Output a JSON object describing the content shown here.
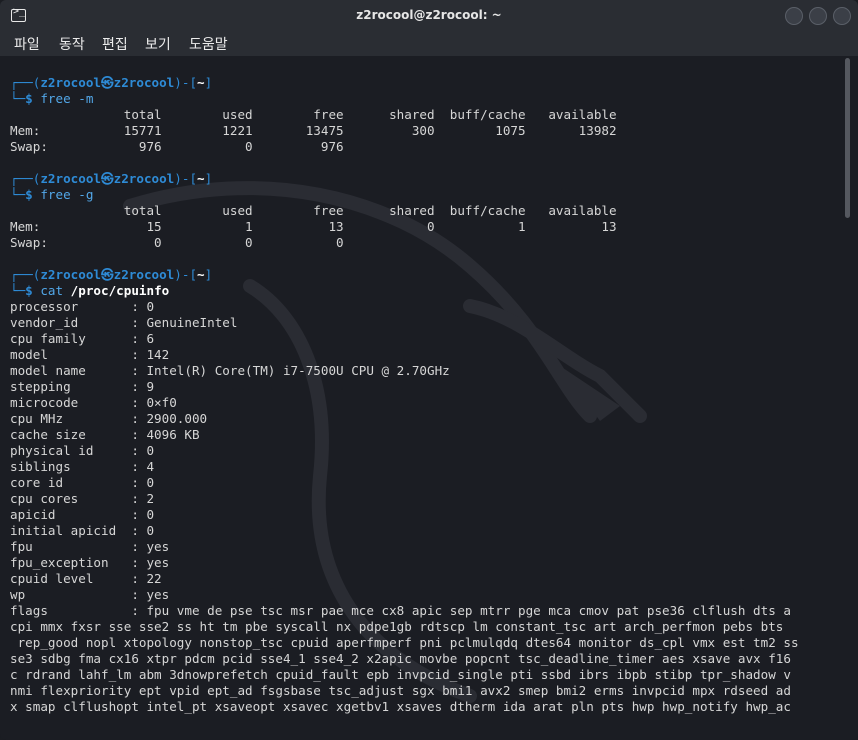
{
  "window": {
    "title": "z2rocool@z2rocool: ~",
    "icon": "terminal-icon",
    "buttons": [
      "minimize-button",
      "maximize-button",
      "close-button"
    ]
  },
  "menu": [
    "파일",
    "동작",
    "편집",
    "보기",
    "도움말"
  ],
  "prompt": {
    "user": "z2rocool",
    "at": "㉿",
    "host": "z2rocool",
    "cwd": "~"
  },
  "commands": {
    "cmd1": "free",
    "cmd1_args": " -m",
    "cmd2": "free",
    "cmd2_args": " -g",
    "cmd3": "cat",
    "cmd3_args": " /proc/cpuinfo"
  },
  "free_m": {
    "header": "               total        used        free      shared  buff/cache   available",
    "mem": "Mem:           15771        1221       13475         300        1075       13982",
    "swap": "Swap:            976           0         976"
  },
  "free_g": {
    "header": "               total        used        free      shared  buff/cache   available",
    "mem": "Mem:              15           1          13           0           1          13",
    "swap": "Swap:              0           0           0"
  },
  "cpuinfo": [
    "processor       : 0",
    "vendor_id       : GenuineIntel",
    "cpu family      : 6",
    "model           : 142",
    "model name      : Intel(R) Core(TM) i7-7500U CPU @ 2.70GHz",
    "stepping        : 9",
    "microcode       : 0×f0",
    "cpu MHz         : 2900.000",
    "cache size      : 4096 KB",
    "physical id     : 0",
    "siblings        : 4",
    "core id         : 0",
    "cpu cores       : 2",
    "apicid          : 0",
    "initial apicid  : 0",
    "fpu             : yes",
    "fpu_exception   : yes",
    "cpuid level     : 22",
    "wp              : yes",
    "flags           : fpu vme de pse tsc msr pae mce cx8 apic sep mtrr pge mca cmov pat pse36 clflush dts a",
    "cpi mmx fxsr sse sse2 ss ht tm pbe syscall nx pdpe1gb rdtscp lm constant_tsc art arch_perfmon pebs bts",
    " rep_good nopl xtopology nonstop_tsc cpuid aperfmperf pni pclmulqdq dtes64 monitor ds_cpl vmx est tm2 ss",
    "se3 sdbg fma cx16 xtpr pdcm pcid sse4_1 sse4_2 x2apic movbe popcnt tsc_deadline_timer aes xsave avx f16",
    "c rdrand lahf_lm abm 3dnowprefetch cpuid_fault epb invpcid_single pti ssbd ibrs ibpb stibp tpr_shadow v",
    "nmi flexpriority ept vpid ept_ad fsgsbase tsc_adjust sgx bmi1 avx2 smep bmi2 erms invpcid mpx rdseed ad",
    "x smap clflushopt intel_pt xsaveopt xsavec xgetbv1 xsaves dtherm ida arat pln pts hwp hwp_notify hwp_ac"
  ],
  "colors": {
    "accent": "#2e8bd6",
    "text": "#d6d6d6",
    "background": "#1b1d23"
  }
}
